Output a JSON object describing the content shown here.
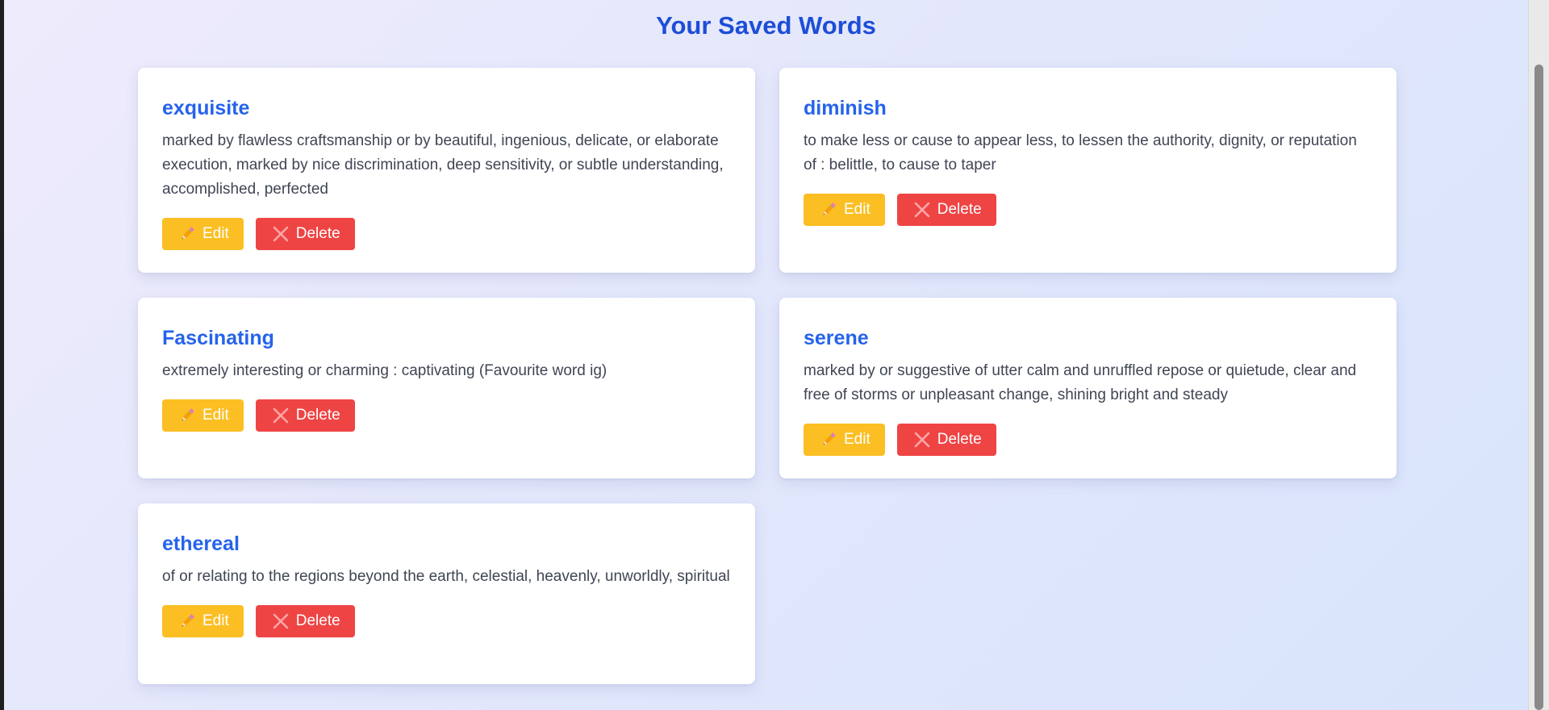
{
  "page": {
    "title": "Your Saved Words"
  },
  "colors": {
    "title": "#1d4ed8",
    "word": "#2563eb",
    "edit_button": "#fbbf24",
    "delete_button": "#ef4444",
    "card_background": "#ffffff"
  },
  "buttons": {
    "edit_label": "Edit",
    "delete_label": "Delete",
    "edit_icon": "pencil-icon",
    "delete_icon": "cross-icon"
  },
  "words": [
    {
      "word": "exquisite",
      "definition": "marked by flawless craftsmanship or by beautiful, ingenious, delicate, or elaborate execution, marked by nice discrimination, deep sensitivity, or subtle understanding, accomplished, perfected"
    },
    {
      "word": "diminish",
      "definition": "to make less or cause to appear less, to lessen the authority, dignity, or reputation of : belittle, to cause to taper"
    },
    {
      "word": "Fascinating",
      "definition": "extremely interesting or charming : captivating (Favourite word ig)"
    },
    {
      "word": "serene",
      "definition": "marked by or suggestive of utter calm and unruffled repose or quietude, clear and free of storms or unpleasant change, shining bright and steady"
    },
    {
      "word": "ethereal",
      "definition": "of or relating to the regions beyond the earth, celestial, heavenly, unworldly, spiritual"
    }
  ]
}
